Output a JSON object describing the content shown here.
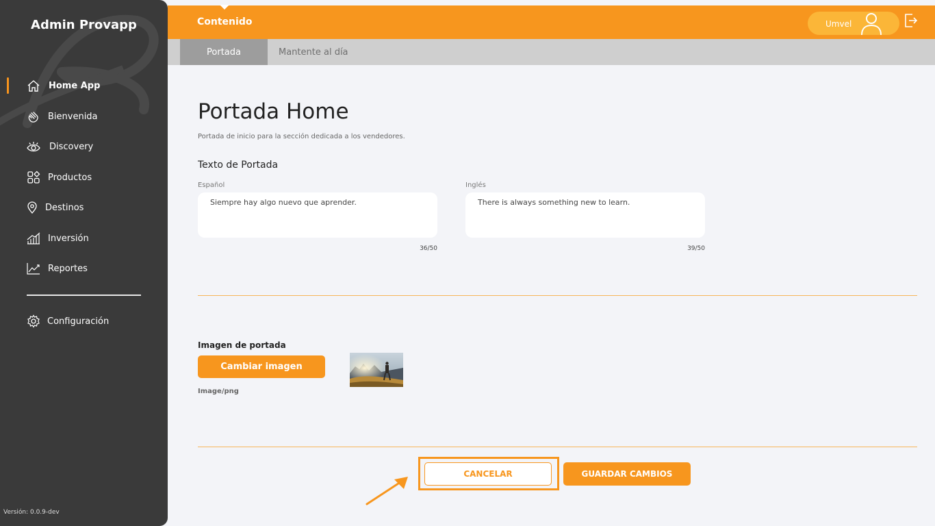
{
  "sidebar": {
    "brand": "Admin Provapp",
    "items": [
      {
        "label": "Home App",
        "icon": "home-icon",
        "active": true
      },
      {
        "label": "Bienvenida",
        "icon": "waving-hand-icon"
      },
      {
        "label": "Discovery",
        "icon": "eye-icon"
      },
      {
        "label": "Productos",
        "icon": "products-grid-icon"
      },
      {
        "label": "Destinos",
        "icon": "location-pin-icon"
      },
      {
        "label": "Inversión",
        "icon": "bar-chart-icon"
      },
      {
        "label": "Reportes",
        "icon": "line-chart-icon"
      }
    ],
    "settings": {
      "label": "Configuración",
      "icon": "gear-icon"
    },
    "version": "Versión: 0.0.9-dev"
  },
  "topbar": {
    "title": "Contenido",
    "user_name": "Umvel",
    "user_icon": "user-icon",
    "logout_icon": "logout-icon"
  },
  "tabs": [
    {
      "label": "Portada",
      "active": true
    },
    {
      "label": "Mantente al día"
    }
  ],
  "main": {
    "title": "Portada Home",
    "subtitle": "Portada de inicio para la sección dedicada a los vendedores.",
    "section_label": "Texto de Portada",
    "fields": [
      {
        "label": "Español",
        "value": "Siempre hay algo nuevo que aprender.",
        "counter": "36/50"
      },
      {
        "label": "Inglés",
        "value": "There is always something new to learn.",
        "counter": "39/50"
      }
    ],
    "image": {
      "label": "Imagen de portada",
      "button": "Cambiar imagen",
      "type": "Image/png"
    },
    "actions": {
      "cancel": "CANCELAR",
      "save": "GUARDAR CAMBIOS"
    }
  },
  "colors": {
    "accent": "#f7961e",
    "sidebar_bg": "#3a3a3a",
    "page_bg": "#f3f4f8"
  }
}
